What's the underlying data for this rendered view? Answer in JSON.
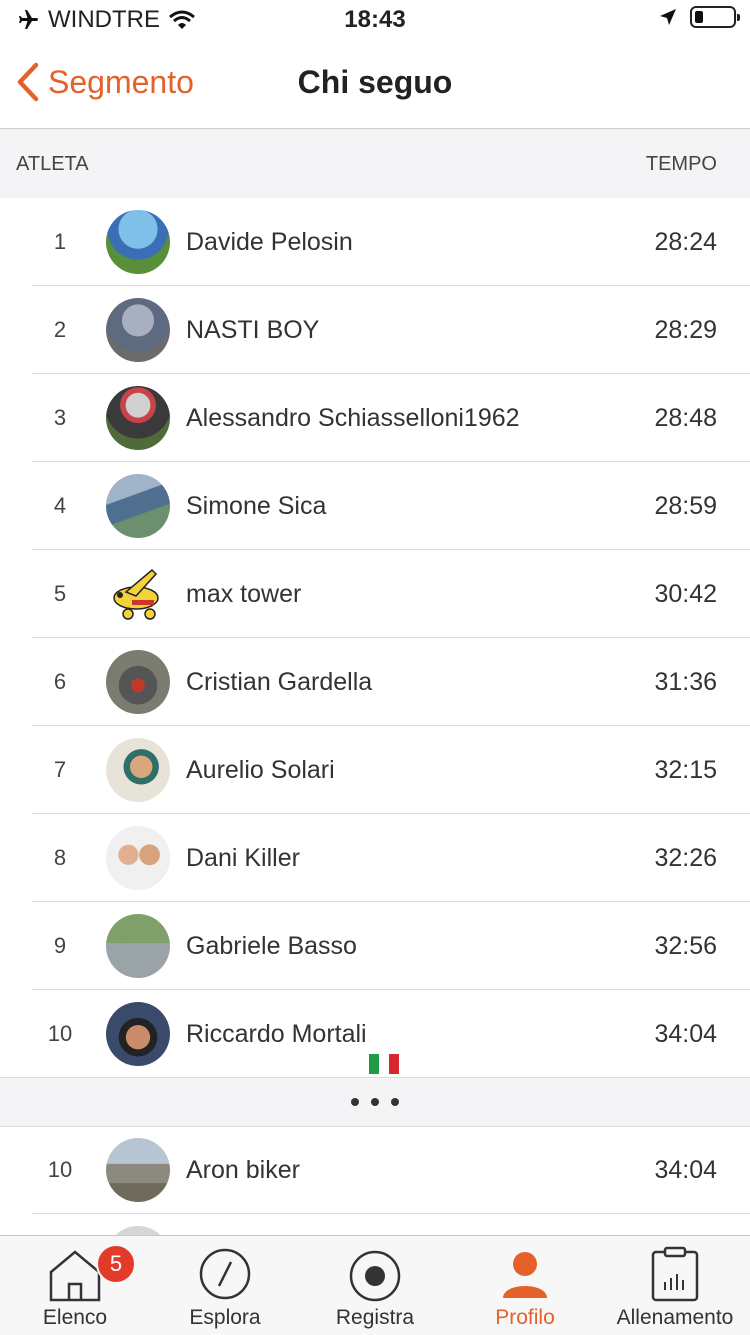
{
  "status_bar": {
    "carrier": "WINDTRE",
    "time": "18:43"
  },
  "nav": {
    "back_label": "Segmento",
    "title": "Chi seguo"
  },
  "table": {
    "col_athlete": "ATLETA",
    "col_time": "TEMPO",
    "rows": [
      {
        "rank": "1",
        "name": "Davide Pelosin",
        "time": "28:24"
      },
      {
        "rank": "2",
        "name": "NASTI BOY",
        "time": "28:29"
      },
      {
        "rank": "3",
        "name": "Alessandro Schiasselloni1962",
        "time": "28:48"
      },
      {
        "rank": "4",
        "name": "Simone Sica",
        "time": "28:59"
      },
      {
        "rank": "5",
        "name": "max tower",
        "time": "30:42"
      },
      {
        "rank": "6",
        "name": "Cristian Gardella",
        "time": "31:36"
      },
      {
        "rank": "7",
        "name": "Aurelio Solari",
        "time": "32:15"
      },
      {
        "rank": "8",
        "name": "Dani Killer",
        "time": "32:26"
      },
      {
        "rank": "9",
        "name": "Gabriele Basso",
        "time": "32:56"
      },
      {
        "rank": "10",
        "name": "Riccardo Mortali",
        "time": "34:04"
      }
    ],
    "me_row": {
      "rank": "10",
      "name": "Aron biker",
      "time": "34:04"
    }
  },
  "tabs": [
    {
      "label": "Elenco",
      "badge": "5"
    },
    {
      "label": "Esplora"
    },
    {
      "label": "Registra"
    },
    {
      "label": "Profilo"
    },
    {
      "label": "Allenamento"
    }
  ],
  "colors": {
    "accent": "#e4622a",
    "badge": "#e23b2a"
  }
}
